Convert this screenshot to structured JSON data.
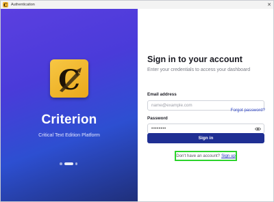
{
  "window": {
    "title": "Authentication",
    "close_glyph": "✕"
  },
  "brand": {
    "logo_letter": "C",
    "name": "Criterion",
    "tagline": "Critical Text Edition Platform",
    "carousel": {
      "count": 3,
      "active_index": 1
    }
  },
  "form": {
    "heading": "Sign in to your account",
    "subheading": "Enter your credentials to access your dashboard",
    "email": {
      "label": "Email address",
      "placeholder": "name@example.com",
      "value": ""
    },
    "password": {
      "label": "Password",
      "masked_value": "••••••••",
      "forgot_label": "Forgot password?"
    },
    "submit_label": "Sign in",
    "signup": {
      "prompt": "Don't have an account?",
      "link_label": "Sign up"
    }
  },
  "colors": {
    "accent": "#1f2f93",
    "link": "#2e44c7",
    "highlight": "#2bd32b",
    "logo_bg": "#f2b632"
  }
}
